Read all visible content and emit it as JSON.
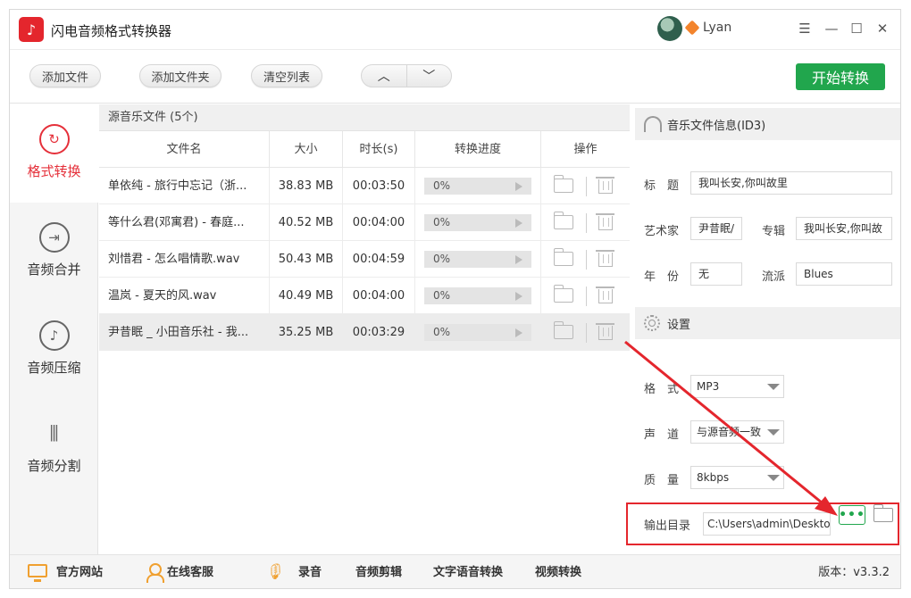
{
  "app": {
    "title": "闪电音频格式转换器",
    "logo_glyph": "♪",
    "username": "Lyan"
  },
  "window_controls": {
    "menu": "☰",
    "minimize": "—",
    "maximize": "☐",
    "close": "✕"
  },
  "toolbar": {
    "add_file": "添加文件",
    "add_folder": "添加文件夹",
    "clear_list": "清空列表",
    "move_up": "︿",
    "move_down": "﹀",
    "start": "开始转换"
  },
  "sidebar": {
    "items": [
      {
        "label": "格式转换",
        "icon": "↻",
        "active": true
      },
      {
        "label": "音频合并",
        "icon": "⇥",
        "active": false
      },
      {
        "label": "音频压缩",
        "icon": "♪",
        "active": false
      },
      {
        "label": "音频分割",
        "icon": "⫴",
        "active": false
      }
    ]
  },
  "filelist": {
    "header": "源音乐文件 (5个)",
    "columns": {
      "name": "文件名",
      "size": "大小",
      "duration": "时长(s)",
      "progress": "转换进度",
      "ops": "操作"
    },
    "rows": [
      {
        "name": "单依纯 - 旅行中忘记（浙...",
        "size": "38.83 MB",
        "duration": "00:03:50",
        "progress": "0%"
      },
      {
        "name": "等什么君(邓寓君) - 春庭...",
        "size": "40.52 MB",
        "duration": "00:04:00",
        "progress": "0%"
      },
      {
        "name": "刘惜君 - 怎么唱情歌.wav",
        "size": "50.43 MB",
        "duration": "00:04:59",
        "progress": "0%"
      },
      {
        "name": "温岚 - 夏天的风.wav",
        "size": "40.49 MB",
        "duration": "00:04:00",
        "progress": "0%"
      },
      {
        "name": "尹昔眠 _ 小田音乐社 - 我...",
        "size": "35.25 MB",
        "duration": "00:03:29",
        "progress": "0%"
      }
    ]
  },
  "id3": {
    "header": "音乐文件信息(ID3)",
    "title_label": "标　题",
    "title_value": "我叫长安,你叫故里",
    "artist_label": "艺术家",
    "artist_value": "尹昔眠/",
    "album_label": "专辑",
    "album_value": "我叫长安,你叫故",
    "year_label": "年　份",
    "year_value": "无",
    "genre_label": "流派",
    "genre_value": "Blues"
  },
  "settings": {
    "header": "设置",
    "format_label": "格　式",
    "format_value": "MP3",
    "channel_label": "声　道",
    "channel_value": "与源音频一致",
    "quality_label": "质　量",
    "quality_value": "8kbps",
    "output_label": "输出目录",
    "output_value": "C:\\Users\\admin\\Desktop",
    "more_label": "•••"
  },
  "footer": {
    "website": "官方网站",
    "service": "在线客服",
    "record": "录音",
    "audio_cut": "音频剪辑",
    "tts": "文字语音转换",
    "video_convert": "视频转换",
    "version": "版本：v3.3.2"
  },
  "colors": {
    "accent_red": "#e5303a",
    "start_green": "#21a64d",
    "annotation_red": "#e4262d"
  }
}
